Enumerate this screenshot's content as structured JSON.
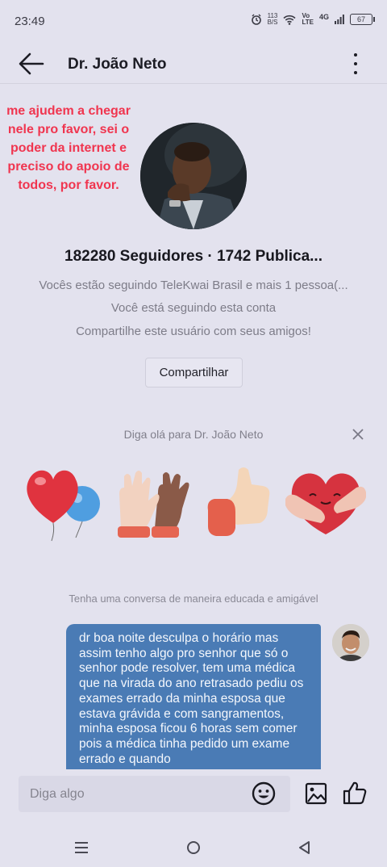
{
  "status_bar": {
    "time": "23:49",
    "speed_value": "113",
    "speed_unit": "B/S",
    "network_top": "Vo",
    "network_bottom": "LTE",
    "network_type": "4G",
    "battery": "67"
  },
  "header": {
    "title": "Dr. João Neto"
  },
  "overlay_caption": "me ajudem a chegar nele pro favor, sei o poder da internet e preciso do apoio de todos, por favor.",
  "profile": {
    "stats": "182280 Seguidores · 1742 Publica...",
    "followed_by": "Vocês estão seguindo TeleKwai Brasil e mais 1 pessoa(...",
    "following_status": "Você está seguindo esta conta",
    "share_prompt": "Compartilhe este usuário com seus amigos!",
    "share_button": "Compartilhar"
  },
  "greeting": {
    "text": "Diga olá para Dr. João Neto",
    "stickers": [
      "heart-balloons",
      "waving-hands",
      "thumbs-up",
      "heart-hug"
    ]
  },
  "chat": {
    "hint": "Tenha uma conversa de maneira educada e amigável",
    "message": "dr boa noite desculpa o horário mas assim tenho algo pro senhor que só o senhor pode resolver, tem uma médica que na virada do ano retrasado pediu os exames errado da minha esposa que estava grávida e com sangramentos, minha esposa ficou 6 horas sem comer pois a médica tinha pedido um exame errado e quando"
  },
  "input": {
    "placeholder": "Diga algo"
  },
  "colors": {
    "background": "#e3e2ee",
    "bubble": "#4a7bb5",
    "overlay_text": "#f0354f"
  }
}
